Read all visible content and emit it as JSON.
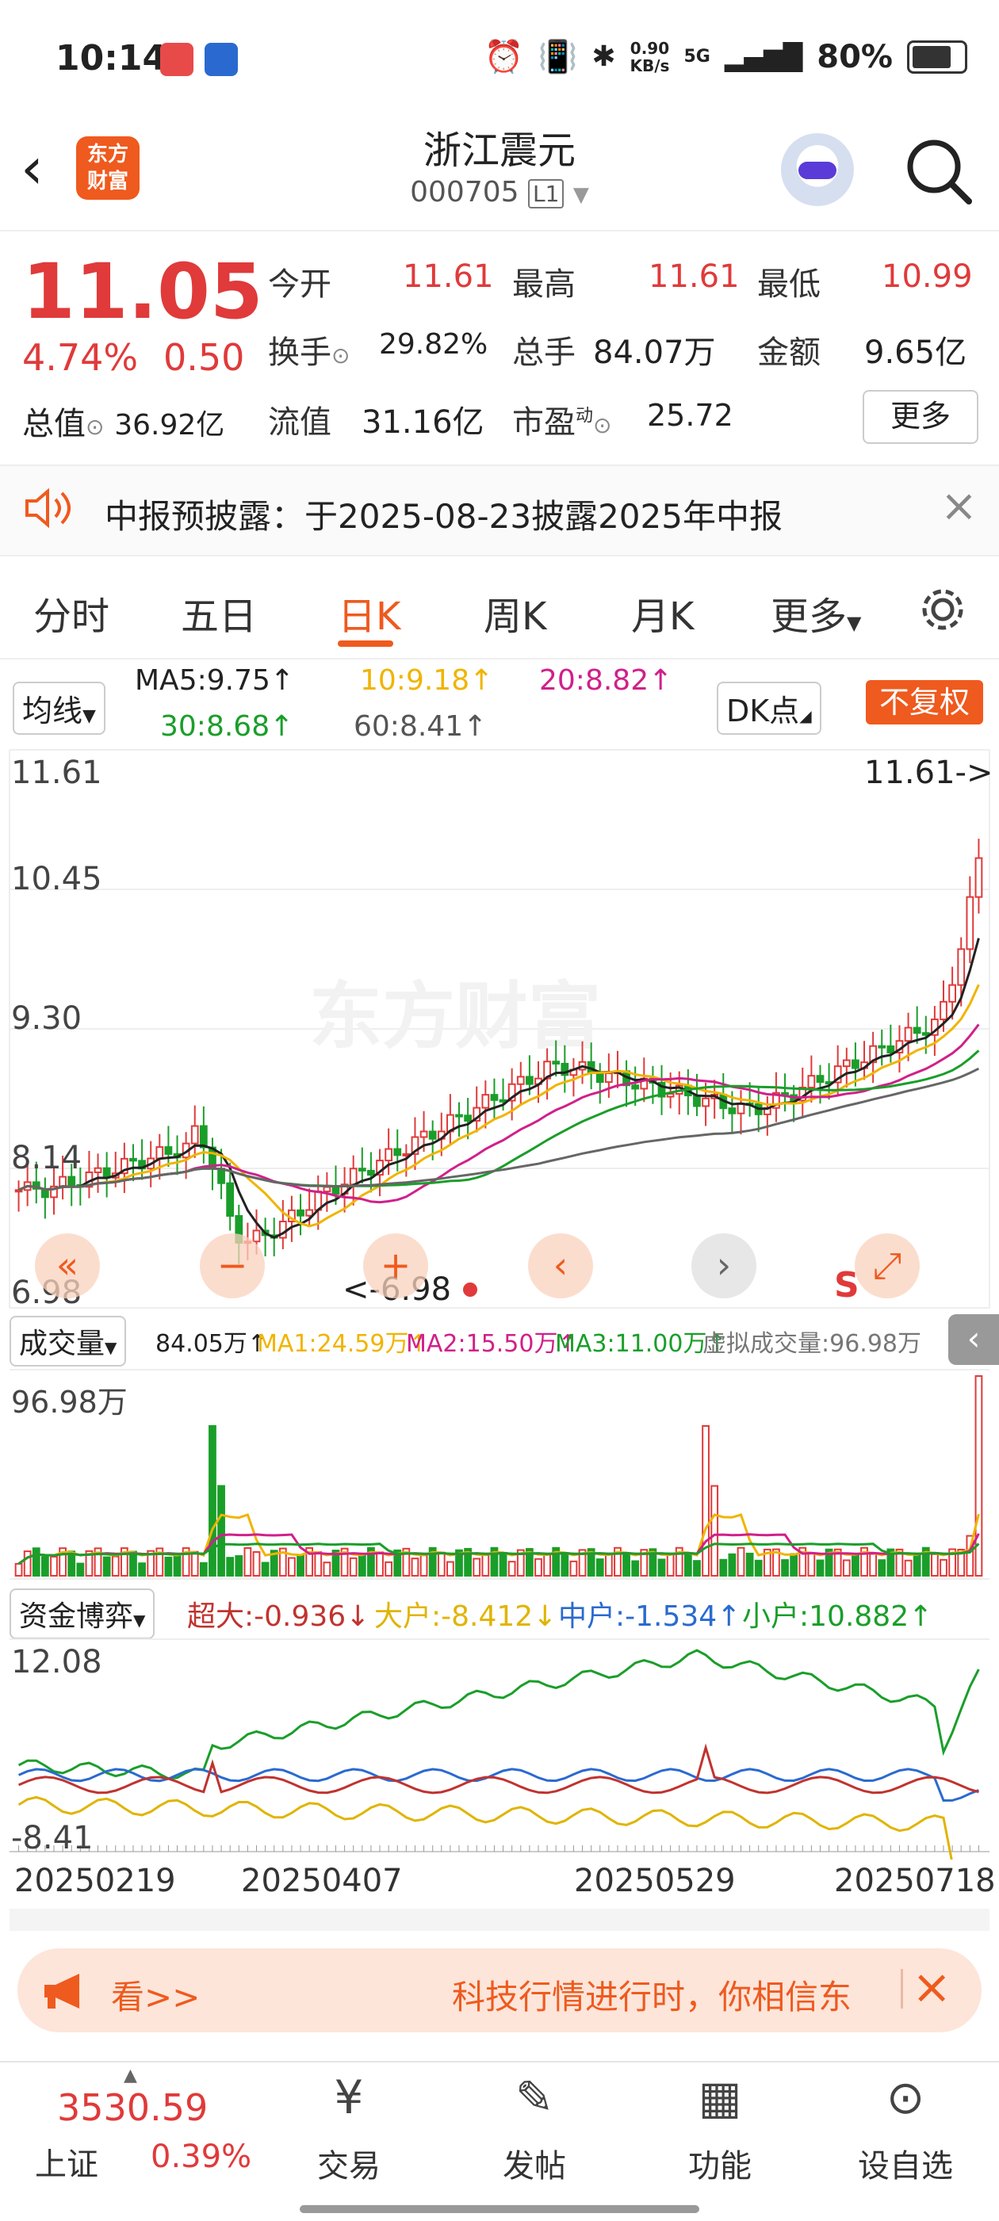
{
  "status_bar": {
    "time": "10:14",
    "net_speed": "0.90",
    "net_unit": "KB/s",
    "signal": "5G",
    "battery": "80%"
  },
  "header": {
    "logo_line1": "东方",
    "logo_line2": "财富",
    "stock_name": "浙江震元",
    "stock_code": "000705",
    "level": "L1"
  },
  "quote": {
    "price": "11.05",
    "change_pct": "4.74%",
    "change": "0.50",
    "open_label": "今开",
    "open": "11.61",
    "high_label": "最高",
    "high": "11.61",
    "low_label": "最低",
    "low": "10.99",
    "turnover_label": "换手",
    "turnover": "29.82%",
    "volume_label": "总手",
    "volume": "84.07万",
    "amount_label": "金额",
    "amount": "9.65亿",
    "total_value_label": "总值",
    "total_value": "36.92亿",
    "float_value_label": "流值",
    "float_value": "31.16亿",
    "pe_label": "市盈",
    "pe_sup": "动",
    "pe": "25.72",
    "more": "更多"
  },
  "notice": {
    "text": "中报预披露：于2025-08-23披露2025年中报"
  },
  "tabs": [
    "分时",
    "五日",
    "日K",
    "周K",
    "月K",
    "更多",
    "设置"
  ],
  "active_tab": "日K",
  "ma_bar": {
    "selector": "均线",
    "ma5": "MA5:9.75",
    "ma10": "10:9.18",
    "ma20": "20:8.82",
    "ma30": "30:8.68",
    "ma60": "60:8.41",
    "dk": "DK点",
    "adjust": "不复权"
  },
  "kline": {
    "y_labels": [
      "11.61",
      "10.45",
      "9.30",
      "8.14",
      "6.98"
    ],
    "max_marker": "11.61->",
    "min_marker": "<-6.98",
    "watermark": "东方财富",
    "marker_s": "S",
    "colors": {
      "up": "#e03a3a",
      "down": "#1a9e2a",
      "ma5": "#222222",
      "ma10": "#f0b400",
      "ma20": "#d0208a",
      "ma30": "#1a9e2a",
      "ma60": "#666666"
    }
  },
  "volume_bar": {
    "selector": "成交量",
    "vol": "84.05万",
    "ma1": "MA1:24.59万",
    "ma2": "MA2:15.50万",
    "ma3": "MA3:11.00万",
    "virtual": "虚拟成交量:96.98万",
    "max": "96.98万"
  },
  "fund_bar": {
    "selector": "资金博弈",
    "super": "超大:-0.936",
    "large": "大户:-8.412",
    "mid": "中户:-1.534",
    "small": "小户:10.882",
    "ymax": "12.08",
    "ymin": "-8.41"
  },
  "dates": [
    "20250219",
    "20250407",
    "20250529",
    "20250718"
  ],
  "banner": {
    "left": "看>>",
    "text": "科技行情进行时，你相信东"
  },
  "bottom_nav": {
    "index_value": "3530.59",
    "index_name": "上证",
    "index_change": "0.39%",
    "items": [
      "交易",
      "发帖",
      "功能",
      "设自选"
    ]
  }
}
